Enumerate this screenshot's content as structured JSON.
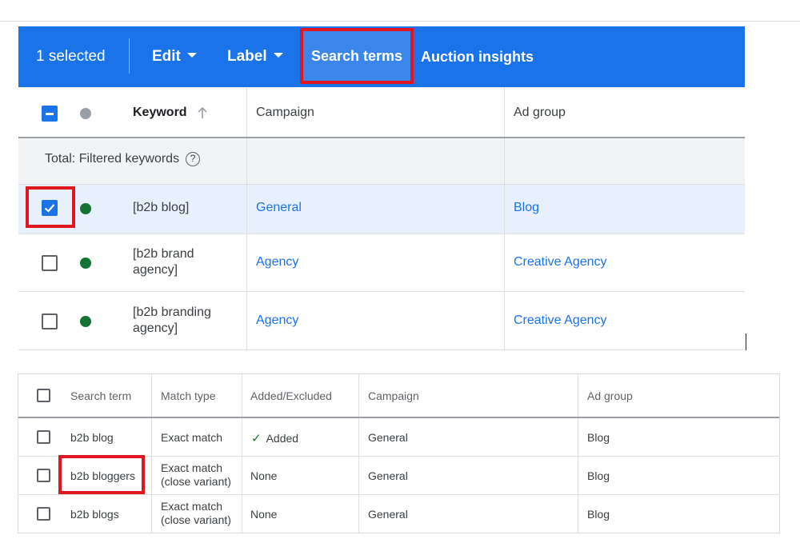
{
  "toolbar": {
    "selected_label": "1 selected",
    "edit_label": "Edit",
    "label_label": "Label",
    "search_terms_label": "Search terms",
    "auction_insights_label": "Auction insights"
  },
  "keywords_table": {
    "headers": {
      "keyword": "Keyword",
      "campaign": "Campaign",
      "ad_group": "Ad group"
    },
    "total_label": "Total: Filtered keywords",
    "rows": [
      {
        "keyword": "[b2b blog]",
        "campaign": "General",
        "ad_group": "Blog",
        "selected": true
      },
      {
        "keyword_line1": "[b2b brand",
        "keyword_line2": "agency]",
        "campaign": "Agency",
        "ad_group": "Creative Agency",
        "selected": false
      },
      {
        "keyword_line1": "[b2b branding",
        "keyword_line2": "agency]",
        "campaign": "Agency",
        "ad_group": "Creative Agency",
        "selected": false
      }
    ]
  },
  "search_terms_table": {
    "headers": {
      "search_term": "Search term",
      "match_type": "Match type",
      "added_excluded": "Added/Excluded",
      "campaign": "Campaign",
      "ad_group": "Ad group"
    },
    "rows": [
      {
        "search_term": "b2b blog",
        "match_type_line1": "Exact match",
        "match_type_line2": "",
        "added_excluded": "Added",
        "campaign": "General",
        "ad_group": "Blog"
      },
      {
        "search_term": "b2b bloggers",
        "match_type_line1": "Exact match",
        "match_type_line2": "(close variant)",
        "added_excluded": "None",
        "campaign": "General",
        "ad_group": "Blog"
      },
      {
        "search_term": "b2b blogs",
        "match_type_line1": "Exact match",
        "match_type_line2": "(close variant)",
        "added_excluded": "None",
        "campaign": "General",
        "ad_group": "Blog"
      }
    ]
  },
  "colors": {
    "toolbar_blue": "#1a73e8",
    "highlight_red": "#e0171f",
    "status_green": "#137333",
    "link_blue": "#1a73e8"
  },
  "icons": {
    "sort": "arrow-up-icon",
    "help": "question-circle-icon",
    "dropdown": "caret-down-icon",
    "added": "checkmark-icon"
  }
}
